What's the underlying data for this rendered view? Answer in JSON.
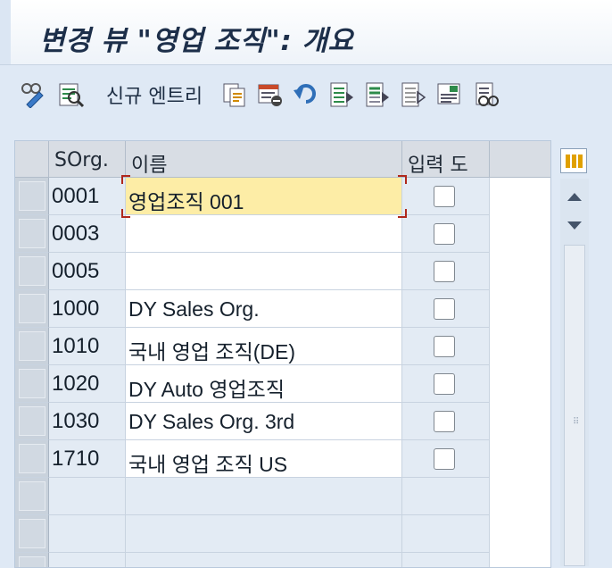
{
  "window": {
    "title": "변경 뷰 \"영업 조직\": 개요"
  },
  "toolbar": {
    "new_entries_label": "신규 엔트리",
    "icons": [
      "display-change-icon",
      "where-used-icon",
      "copy-as-icon",
      "delete-icon",
      "undo-icon",
      "select-all-icon",
      "select-block-icon",
      "deselect-all-icon",
      "print-icon",
      "details-icon"
    ]
  },
  "table": {
    "columns": {
      "sorg": "SOrg.",
      "name": "이름",
      "flag": "입력 도"
    },
    "rows": [
      {
        "sorg": "0001",
        "name": "영업조직 001",
        "checked": false
      },
      {
        "sorg": "0003",
        "name": "",
        "checked": false
      },
      {
        "sorg": "0005",
        "name": "",
        "checked": false
      },
      {
        "sorg": "1000",
        "name": "DY Sales Org.",
        "checked": false
      },
      {
        "sorg": "1010",
        "name": "국내 영업 조직(DE)",
        "checked": false
      },
      {
        "sorg": "1020",
        "name": "DY Auto 영업조직",
        "checked": false
      },
      {
        "sorg": "1030",
        "name": "DY Sales Org. 3rd",
        "checked": false
      },
      {
        "sorg": "1710",
        "name": "국내 영업 조직 US",
        "checked": false
      }
    ],
    "active_cell": "영업조직 001"
  },
  "colors": {
    "active_cell_bg": "#fdeda6",
    "header_bg": "#d8dde4",
    "row_alt_bg": "#e3ebf4"
  }
}
